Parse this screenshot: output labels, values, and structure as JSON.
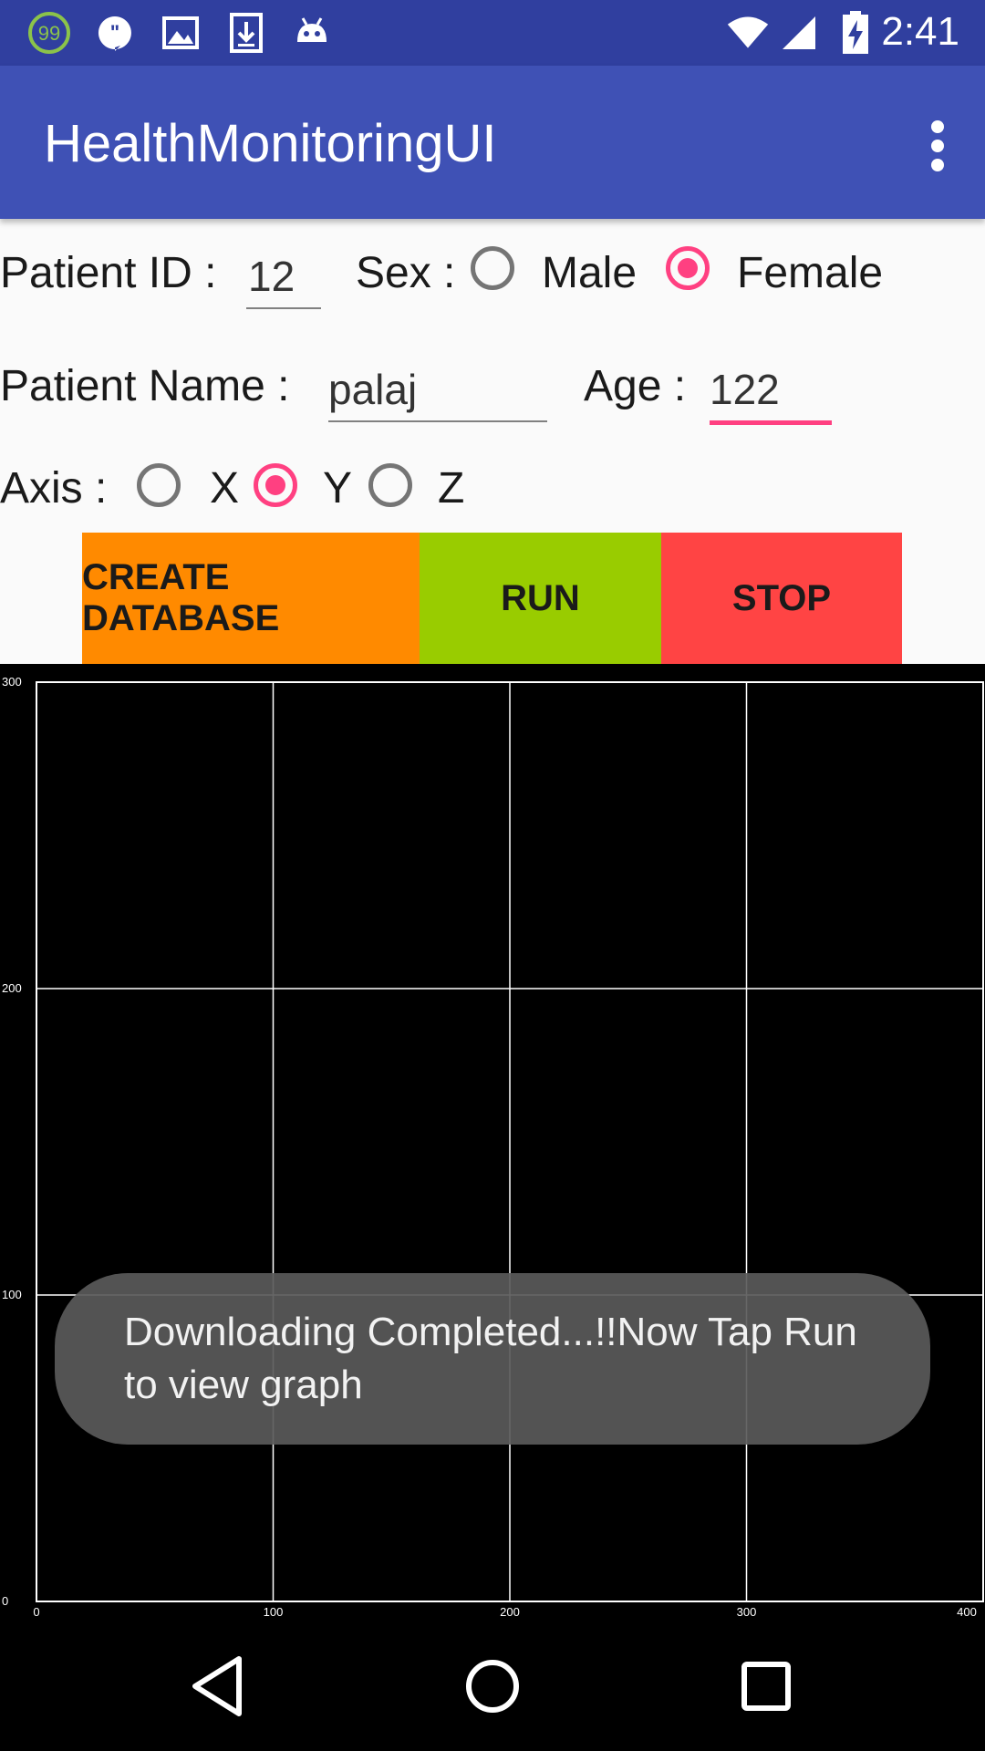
{
  "status_bar": {
    "time": "2:41",
    "badge_count": "99",
    "icons": [
      "counter-badge-icon",
      "hangouts-icon",
      "image-icon",
      "download-icon",
      "android-icon",
      "wifi-icon",
      "signal-icon",
      "battery-charging-icon"
    ]
  },
  "app_bar": {
    "title": "HealthMonitoringUI",
    "menu_icon": "overflow-menu-icon"
  },
  "form": {
    "patient_id_label": "Patient ID :",
    "patient_id_value": "12",
    "sex_label": "Sex :",
    "sex_options": [
      {
        "label": "Male",
        "checked": false
      },
      {
        "label": "Female",
        "checked": true
      }
    ],
    "patient_name_label": "Patient Name :",
    "patient_name_value": "palaj",
    "age_label": "Age :",
    "age_value": "122",
    "axis_label": "Axis :",
    "axis_options": [
      {
        "label": "X",
        "checked": false
      },
      {
        "label": "Y",
        "checked": true
      },
      {
        "label": "Z",
        "checked": false
      }
    ]
  },
  "buttons": {
    "create_database": "CREATE DATABASE",
    "run": "RUN",
    "stop": "STOP",
    "colors": {
      "create_database": "#ff8a00",
      "run": "#99cc00",
      "stop": "#ff4444"
    }
  },
  "chart_data": {
    "type": "line",
    "series": [],
    "xlim": [
      0,
      400
    ],
    "ylim": [
      0,
      300
    ],
    "x_ticks": [
      "0",
      "100",
      "200",
      "300",
      "400"
    ],
    "y_ticks": [
      "0",
      "100",
      "200",
      "300"
    ],
    "grid": true
  },
  "toast": {
    "message": "Downloading Completed...!!Now Tap Run to view graph"
  },
  "nav_bar": {
    "icons": [
      "back-icon",
      "home-icon",
      "recents-icon"
    ]
  }
}
